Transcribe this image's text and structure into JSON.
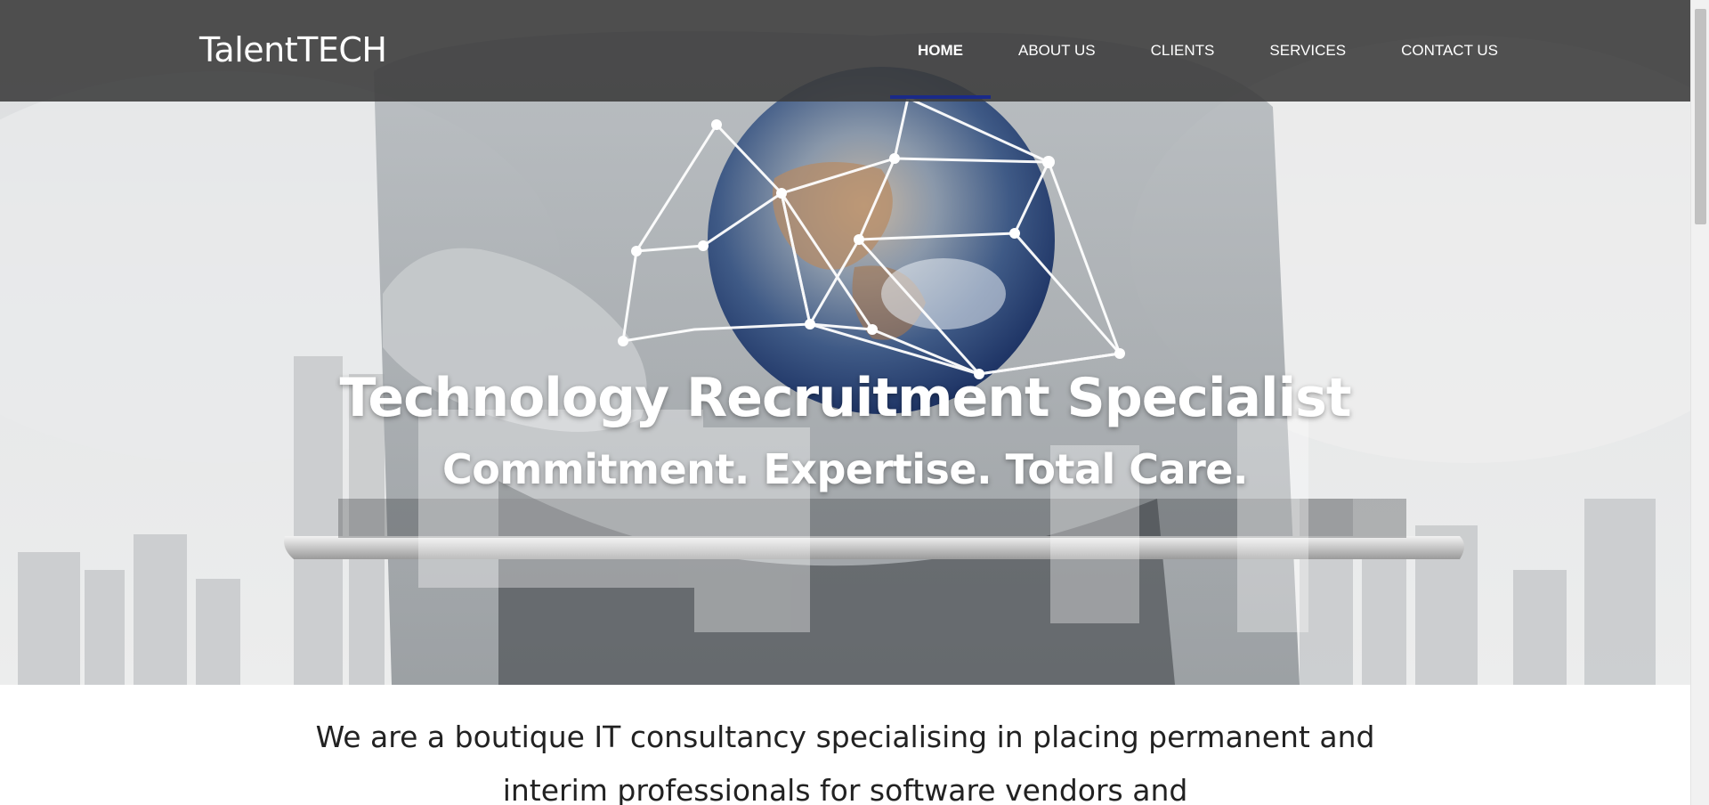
{
  "header": {
    "logo_text": "TalentTECH",
    "nav": [
      {
        "label": "HOME",
        "active": true
      },
      {
        "label": "ABOUT US",
        "active": false
      },
      {
        "label": "CLIENTS",
        "active": false
      },
      {
        "label": "SERVICES",
        "active": false
      },
      {
        "label": "CONTACT US",
        "active": false
      }
    ],
    "active_indicator_color": "#1a2a8a",
    "background_color": "#3a3a3a"
  },
  "hero": {
    "title": "Technology Recruitment Specialist",
    "subtitle": "Commitment. Expertise. Total Care.",
    "image_subject": "hands holding tablet with earth globe and network lines"
  },
  "intro": {
    "line1": "We are a boutique IT consultancy specialising in placing permanent and",
    "line2": "interim professionals for software vendors and"
  },
  "icons": {
    "globe": "globe-icon",
    "tablet": "tablet-icon"
  }
}
